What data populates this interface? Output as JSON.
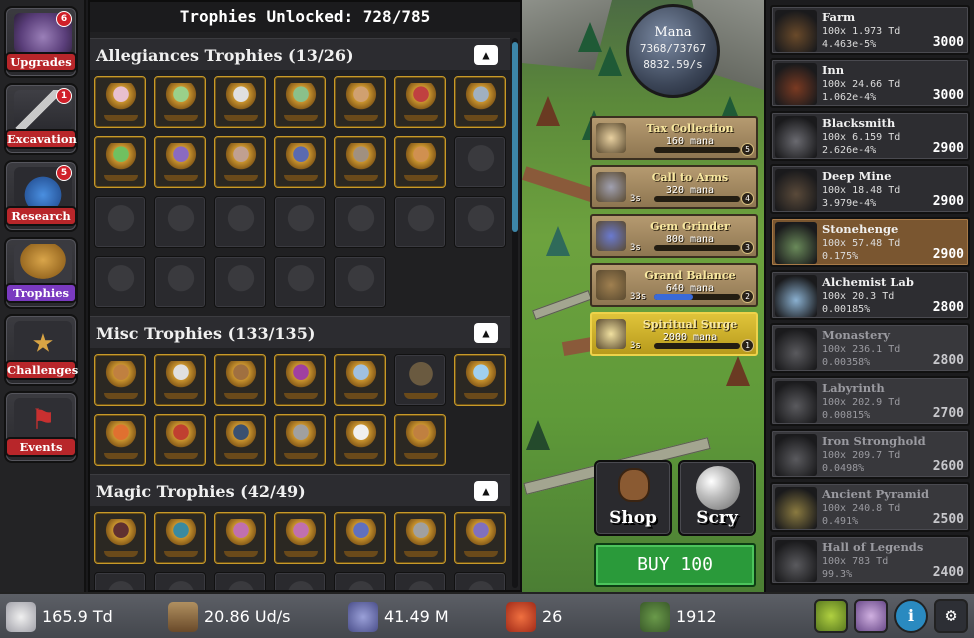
{
  "nav": [
    {
      "label": "Upgrades",
      "badge": "6",
      "icon": "upgrades-icon"
    },
    {
      "label": "Excavation",
      "badge": "1",
      "icon": "shovel-icon"
    },
    {
      "label": "Research",
      "badge": "5",
      "icon": "potion-icon"
    },
    {
      "label": "Trophies",
      "badge": "",
      "icon": "trophy-icon",
      "active": true
    },
    {
      "label": "Challenges",
      "badge": "",
      "icon": "star-icon"
    },
    {
      "label": "Events",
      "badge": "",
      "icon": "flag-icon"
    }
  ],
  "trophies": {
    "header": "Trophies Unlocked: 728/785",
    "sections": [
      {
        "title": "Allegiances Trophies (13/26)"
      },
      {
        "title": "Misc Trophies (133/135)"
      },
      {
        "title": "Magic Trophies (42/49)"
      }
    ]
  },
  "mana": {
    "title": "Mana",
    "value": "7368/73767",
    "rate": "8832.59/s"
  },
  "spells": [
    {
      "name": "Tax Collection",
      "cost": "160 mana",
      "time": "",
      "level": "5",
      "progress": 0,
      "icon": "hand-icon"
    },
    {
      "name": "Call to Arms",
      "cost": "320 mana",
      "time": "3s",
      "level": "4",
      "progress": 0,
      "icon": "shield-sword-icon"
    },
    {
      "name": "Gem Grinder",
      "cost": "800 mana",
      "time": "3s",
      "level": "3",
      "progress": 0,
      "icon": "gem-icon"
    },
    {
      "name": "Grand Balance",
      "cost": "640 mana",
      "time": "33s",
      "level": "2",
      "progress": 0.45,
      "icon": "scales-icon"
    },
    {
      "name": "Spiritual Surge",
      "cost": "2000 mana",
      "time": "3s",
      "level": "1",
      "progress": 0,
      "icon": "ankh-icon",
      "active": true
    }
  ],
  "shop_label": "Shop",
  "scry_label": "Scry",
  "buy_label": "BUY 100",
  "buildings": [
    {
      "name": "Farm",
      "count": "100x 1.973 Td",
      "rate": "4.463e-5%",
      "cost": "3000"
    },
    {
      "name": "Inn",
      "count": "100x 24.66 Td",
      "rate": "1.062e-4%",
      "cost": "3000"
    },
    {
      "name": "Blacksmith",
      "count": "100x 6.159 Td",
      "rate": "2.626e-4%",
      "cost": "2900"
    },
    {
      "name": "Deep Mine",
      "count": "100x 18.48 Td",
      "rate": "3.979e-4%",
      "cost": "2900"
    },
    {
      "name": "Stonehenge",
      "count": "100x 57.48 Td",
      "rate": "0.175%",
      "cost": "2900",
      "current": true
    },
    {
      "name": "Alchemist Lab",
      "count": "100x 20.3 Td",
      "rate": "0.00185%",
      "cost": "2800"
    },
    {
      "name": "Monastery",
      "count": "100x 236.1 Td",
      "rate": "0.00358%",
      "cost": "2800",
      "locked": true
    },
    {
      "name": "Labyrinth",
      "count": "100x 202.9 Td",
      "rate": "0.00815%",
      "cost": "2700",
      "locked": true
    },
    {
      "name": "Iron Stronghold",
      "count": "100x 209.7 Td",
      "rate": "0.0498%",
      "cost": "2600",
      "locked": true
    },
    {
      "name": "Ancient Pyramid",
      "count": "100x 240.8 Td",
      "rate": "0.491%",
      "cost": "2500",
      "locked": true
    },
    {
      "name": "Hall of Legends",
      "count": "100x 783 Td",
      "rate": "99.3%",
      "cost": "2400",
      "locked": true
    }
  ],
  "resources": [
    {
      "value": "165.9 Td",
      "icon": "coin-icon"
    },
    {
      "value": "20.86 Ud/s",
      "icon": "excavation-icon"
    },
    {
      "value": "41.49 M",
      "icon": "gem-icon"
    },
    {
      "value": "26",
      "icon": "ruby-icon"
    },
    {
      "value": "1912",
      "icon": "faction-icon"
    }
  ]
}
